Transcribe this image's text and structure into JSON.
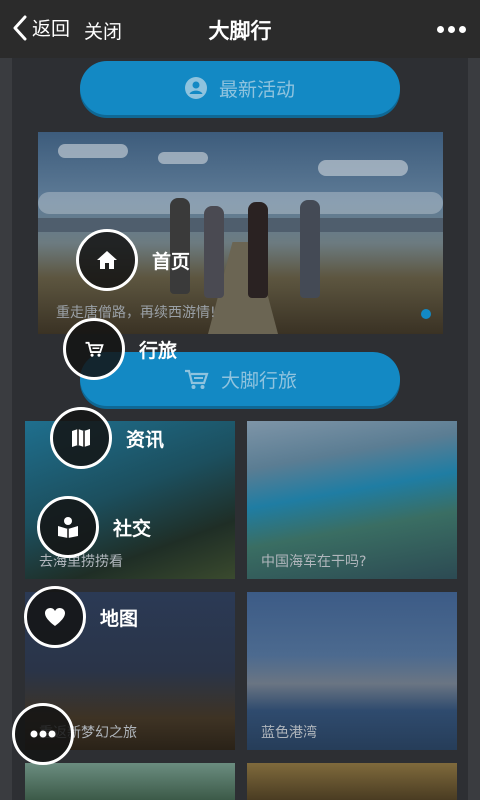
{
  "topbar": {
    "back_label": "返回",
    "close_label": "关闭",
    "title": "大脚行",
    "more_icon": "more-icon"
  },
  "content": {
    "pill1_label": "最新活动",
    "pill1_icon": "user-icon",
    "banner_caption": "重走唐僧路，再续西游情!",
    "pill2_label": "大脚行旅",
    "pill2_icon": "cart-icon",
    "tiles": [
      {
        "caption": "去海里捞捞看"
      },
      {
        "caption": "中国海军在干吗?"
      },
      {
        "caption": "重返新梦幻之旅"
      },
      {
        "caption": "蓝色港湾"
      }
    ]
  },
  "float_menu": {
    "items": [
      {
        "label": "首页",
        "icon": "home-icon"
      },
      {
        "label": "行旅",
        "icon": "cart-icon"
      },
      {
        "label": "资讯",
        "icon": "map-icon"
      },
      {
        "label": "社交",
        "icon": "book-reader-icon"
      },
      {
        "label": "地图",
        "icon": "heart-icon"
      }
    ],
    "toggle_icon": "more-dots-icon"
  },
  "colors": {
    "accent": "#1389c4",
    "topbar_bg": "#2b2b2b"
  }
}
